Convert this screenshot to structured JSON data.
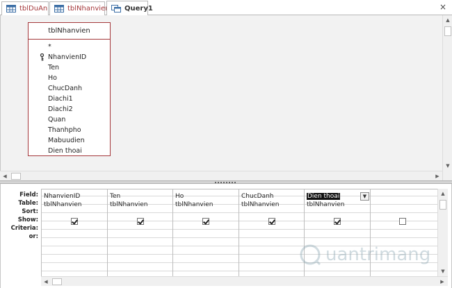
{
  "tabs": [
    {
      "label": "tblDuAn",
      "icon": "table-icon"
    },
    {
      "label": "tblNhanvien",
      "icon": "table-icon"
    },
    {
      "label": "Query1",
      "icon": "query-icon"
    }
  ],
  "close_glyph": "×",
  "field_list": {
    "title": "tblNhanvien",
    "fields": [
      "*",
      "NhanvienID",
      "Ten",
      "Ho",
      "ChucDanh",
      "Diachi1",
      "Diachi2",
      "Quan",
      "Thanhpho",
      "Mabuudien",
      "Dien thoai"
    ],
    "primary_key": "NhanvienID"
  },
  "grid": {
    "row_labels": [
      "Field:",
      "Table:",
      "Sort:",
      "Show:",
      "Criteria:",
      "or:"
    ],
    "columns": [
      {
        "field": "NhanvienID",
        "table": "tblNhanvien",
        "show": true
      },
      {
        "field": "Ten",
        "table": "tblNhanvien",
        "show": true
      },
      {
        "field": "Ho",
        "table": "tblNhanvien",
        "show": true
      },
      {
        "field": "ChucDanh",
        "table": "tblNhanvien",
        "show": true
      },
      {
        "field": "Dien thoai",
        "table": "tblNhanvien",
        "show": true,
        "selected": true
      },
      {
        "field": "",
        "table": "",
        "show": false
      }
    ]
  },
  "watermark": "uantrimang",
  "colors": {
    "accent": "#a4373a"
  }
}
